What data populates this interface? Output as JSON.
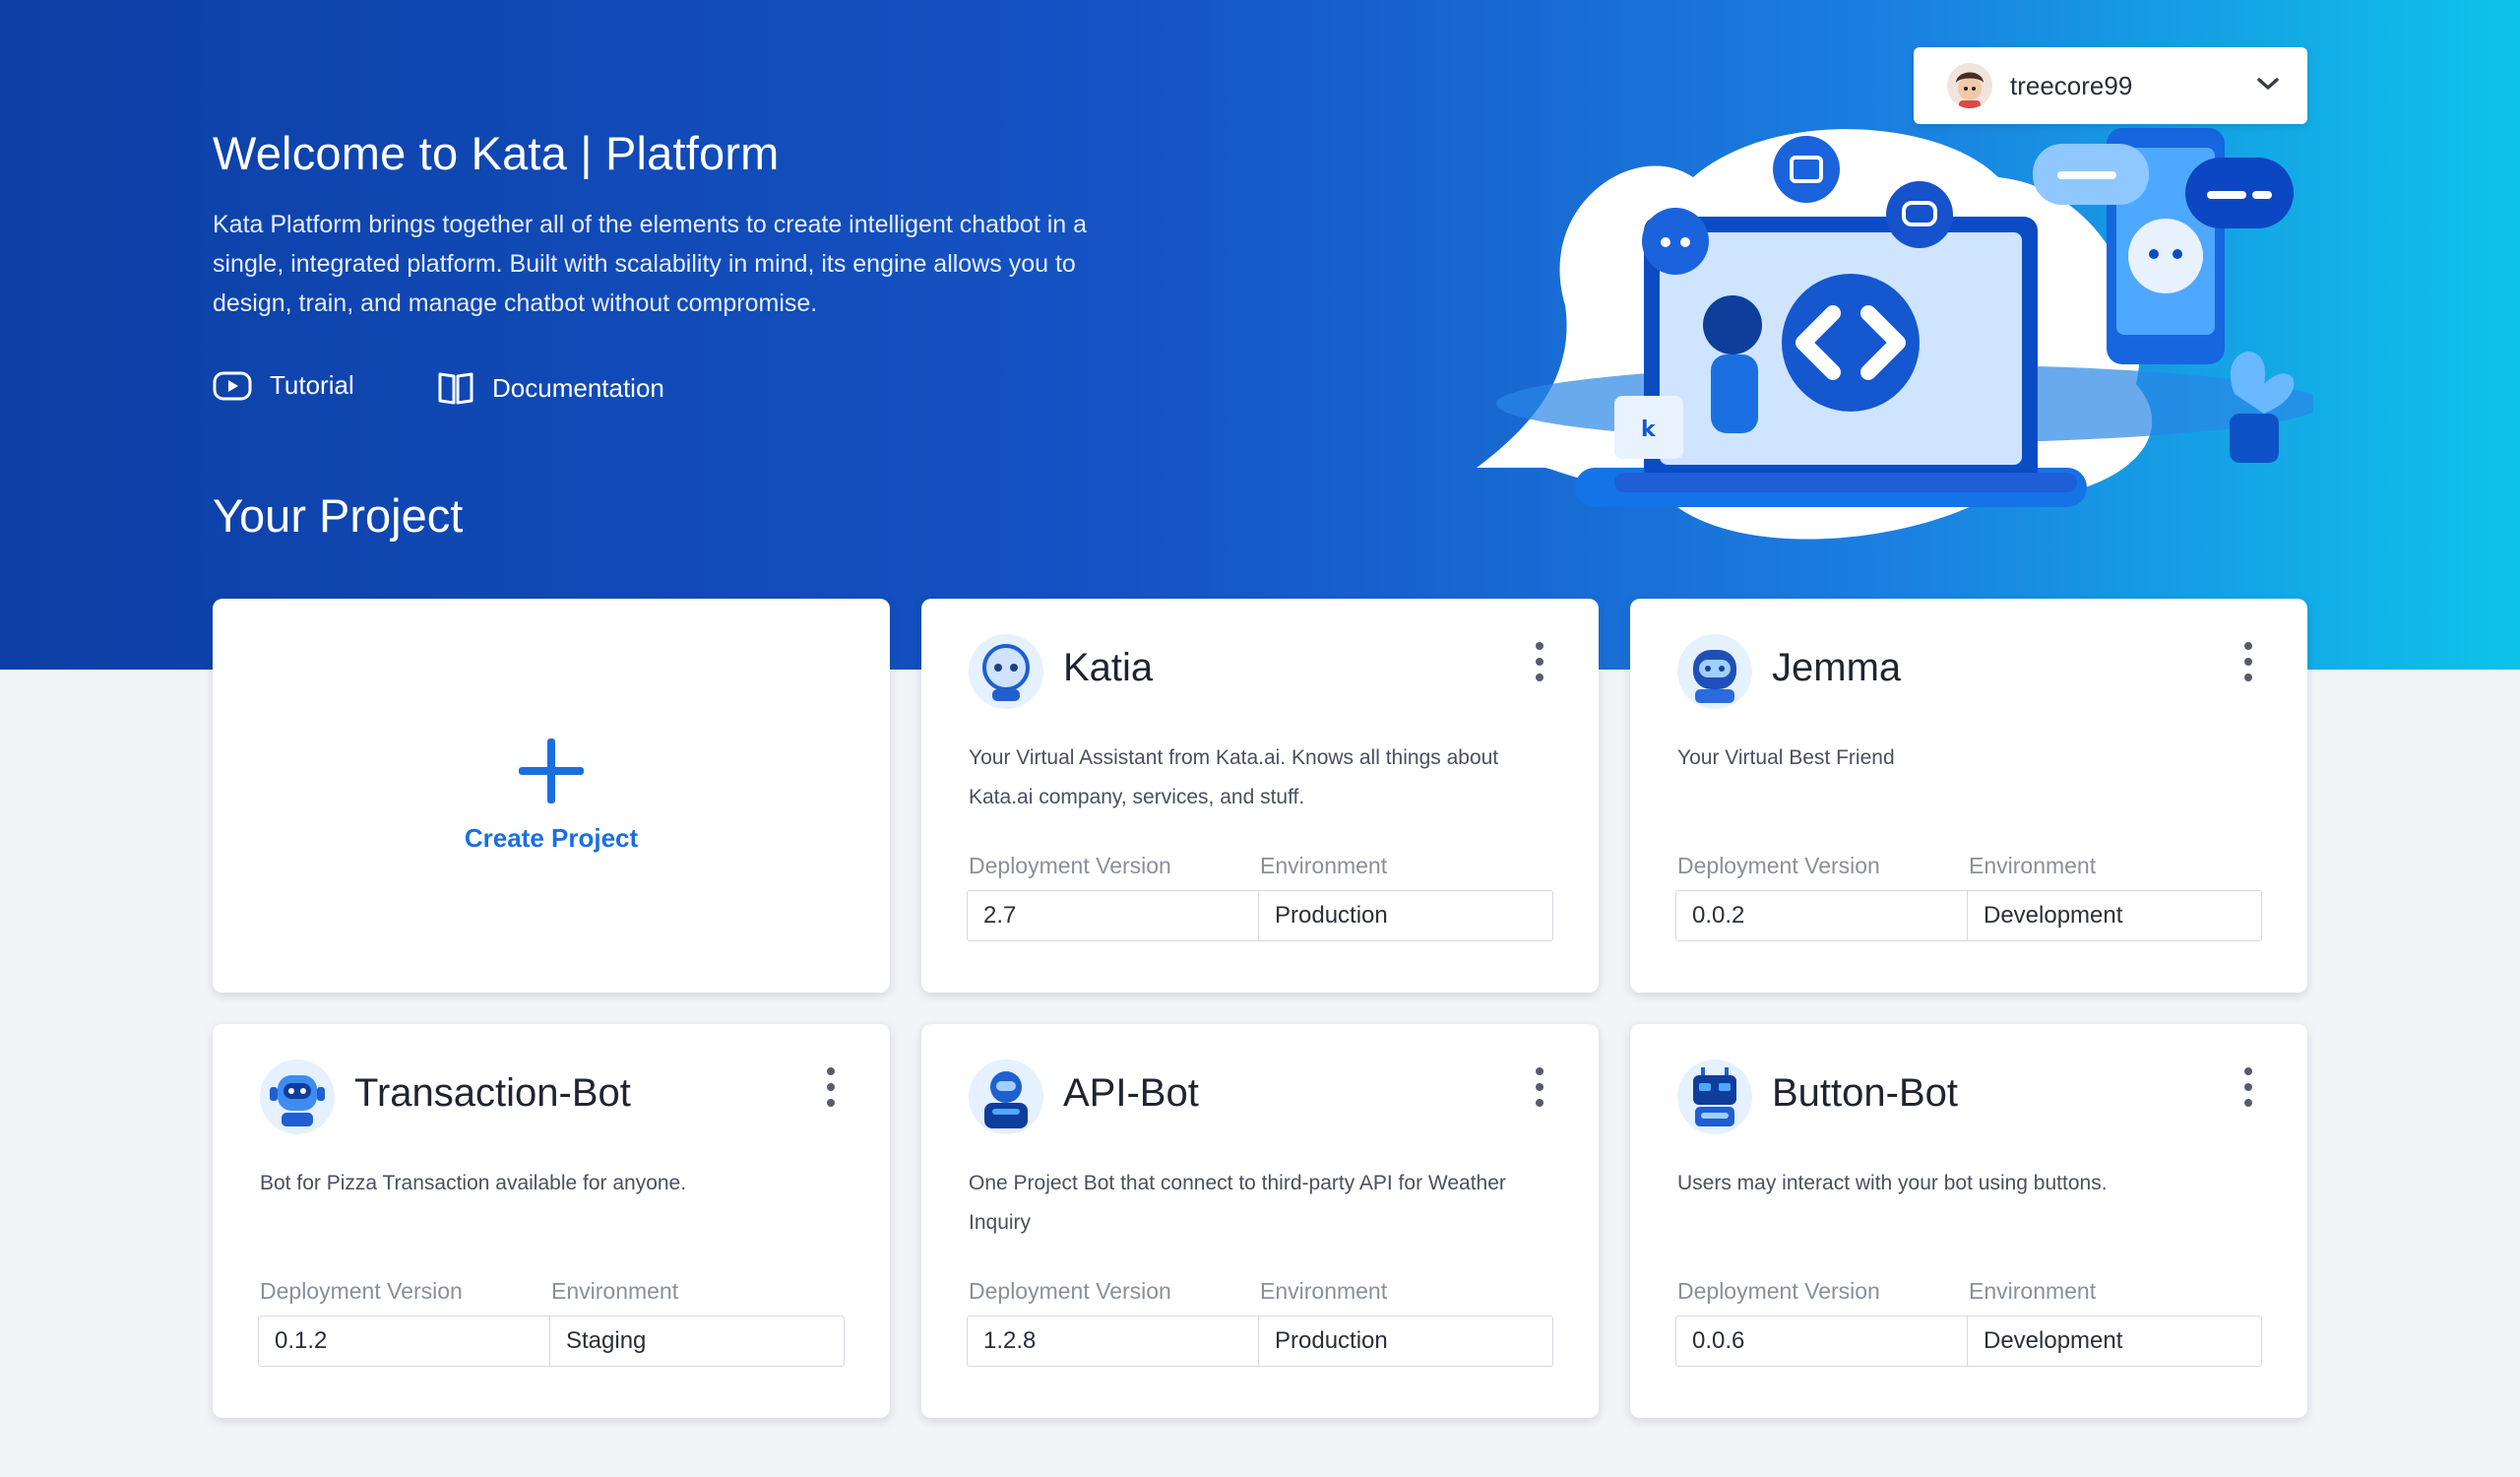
{
  "header": {
    "title": "Welcome to Kata | Platform",
    "description": "Kata Platform brings together all of the elements to create intelligent chatbot in a single, integrated platform. Built with scalability in mind, its engine allows you to design, train, and manage chatbot without compromise.",
    "links": {
      "tutorial": "Tutorial",
      "documentation": "Documentation"
    }
  },
  "user": {
    "name": "treecore99"
  },
  "section_title": "Your Project",
  "create_project": {
    "label": "Create Project"
  },
  "columns": {
    "deployment_version": "Deployment Version",
    "environment": "Environment"
  },
  "projects": [
    {
      "name": "Katia",
      "description": "Your Virtual Assistant from Kata.ai. Knows all things about Kata.ai company, services, and stuff.",
      "version": "2.7",
      "environment": "Production"
    },
    {
      "name": "Jemma",
      "description": "Your Virtual Best Friend",
      "version": "0.0.2",
      "environment": "Development"
    },
    {
      "name": "Transaction-Bot",
      "description": "Bot for Pizza Transaction available for anyone.",
      "version": "0.1.2",
      "environment": "Staging"
    },
    {
      "name": "API-Bot",
      "description": "One Project Bot that connect to third-party API for Weather Inquiry",
      "version": "1.2.8",
      "environment": "Production"
    },
    {
      "name": "Button-Bot",
      "description": "Users may interact with your bot using buttons.",
      "version": "0.0.6",
      "environment": "Development"
    }
  ],
  "colors": {
    "accent": "#1a6fe0",
    "hero_start": "#0d3fa6",
    "hero_end": "#0ec3ea",
    "page_bg": "#f3f4f7"
  },
  "icons": [
    "play-icon",
    "book-icon",
    "chevron-down-icon",
    "plus-icon",
    "kebab-menu-icon",
    "bot-avatar-icon"
  ]
}
